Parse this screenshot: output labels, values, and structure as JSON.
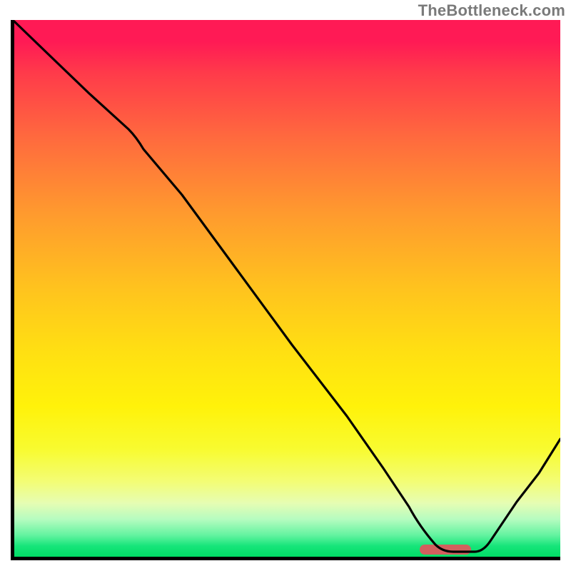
{
  "watermark": "TheBottleneck.com",
  "chart_data": {
    "type": "line",
    "title": "",
    "xlabel": "",
    "ylabel": "",
    "xlim": [
      0,
      100
    ],
    "ylim": [
      0,
      100
    ],
    "grid": false,
    "legend": false,
    "background": {
      "type": "vertical-gradient",
      "stops": [
        {
          "pos": 0,
          "color": "#ff1a55"
        },
        {
          "pos": 50,
          "color": "#ffc31e"
        },
        {
          "pos": 80,
          "color": "#f3fd75"
        },
        {
          "pos": 100,
          "color": "#00dd66"
        }
      ]
    },
    "series": [
      {
        "name": "bottleneck-curve",
        "color": "#000000",
        "x": [
          0,
          7,
          14,
          21,
          23,
          30,
          40,
          50,
          60,
          67,
          72,
          77,
          80,
          84,
          88,
          92,
          96,
          100
        ],
        "y": [
          100,
          93,
          86,
          80,
          78,
          68,
          54,
          40,
          27,
          17,
          9,
          2,
          1,
          1,
          1,
          7,
          15,
          23
        ]
      }
    ],
    "marker": {
      "name": "optimal-range",
      "color": "#d2605e",
      "x_start": 74,
      "x_end": 84,
      "y": 1
    }
  }
}
